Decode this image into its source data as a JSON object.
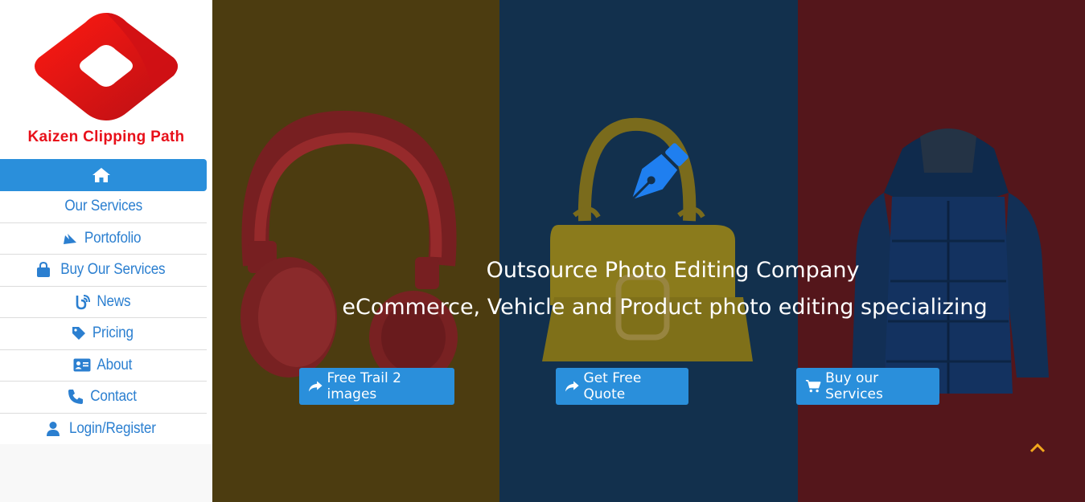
{
  "brand": {
    "name": "Kaizen Clipping Path",
    "color": "#e8101a"
  },
  "nav": {
    "items": [
      {
        "label": "",
        "icon": "home-icon"
      },
      {
        "label": "Our Services",
        "icon": ""
      },
      {
        "label": "Portofolio",
        "icon": "portfolio-icon"
      },
      {
        "label": "Buy Our Services",
        "icon": "shopping-bag-icon"
      },
      {
        "label": "News",
        "icon": "blog-icon"
      },
      {
        "label": "Pricing",
        "icon": "tag-icon"
      },
      {
        "label": "About",
        "icon": "id-card-icon"
      },
      {
        "label": "Contact",
        "icon": "phone-icon"
      },
      {
        "label": "Login/Register",
        "icon": "user-icon"
      }
    ],
    "accent": "#2a8fdb"
  },
  "hero": {
    "headline_1": "Outsource Photo Editing Company",
    "headline_2": "eCommerce, Vehicle and Product photo editing specializing",
    "buttons": {
      "free_trial": "Free Trail 2 images",
      "free_quote": "Get Free Quote",
      "buy_services": "Buy our Services"
    },
    "panel_colors": [
      "#4c3c10",
      "#12304d",
      "#54161b"
    ]
  }
}
